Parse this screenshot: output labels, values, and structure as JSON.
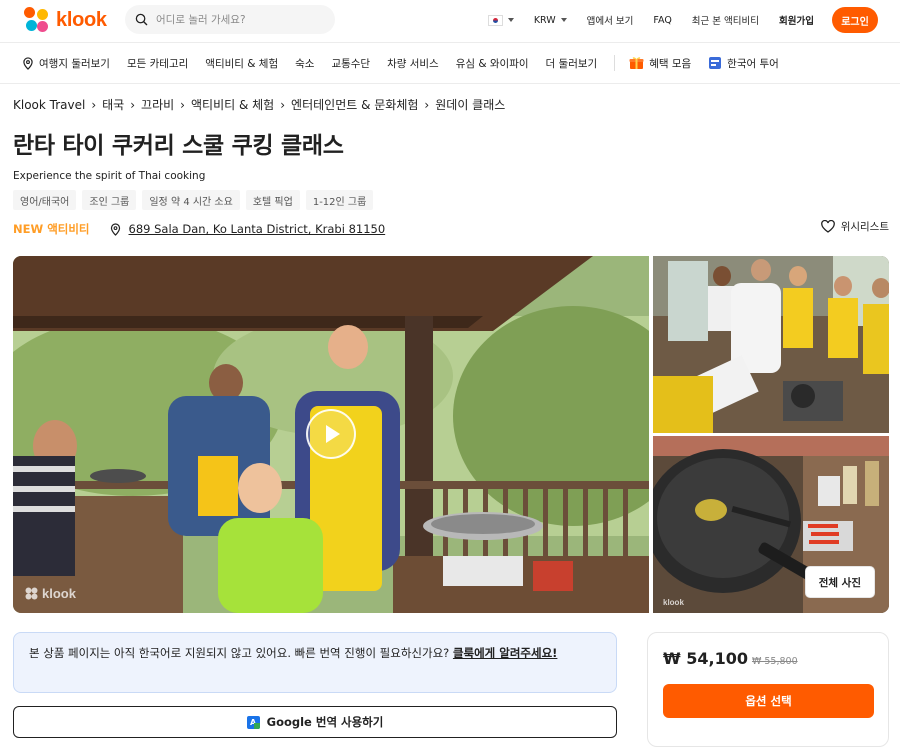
{
  "header": {
    "logo_text": "klook",
    "search_placeholder": "어디로 놀러 가세요?",
    "currency": "KRW",
    "app_link": "앱에서 보기",
    "faq": "FAQ",
    "recent": "최근 본 액티비티",
    "signup": "회원가입",
    "login": "로그인"
  },
  "nav": {
    "items": [
      "여행지 둘러보기",
      "모든 카테고리",
      "액티비티 & 체험",
      "숙소",
      "교통수단",
      "차량 서비스",
      "유심 & 와이파이",
      "더 둘러보기"
    ],
    "deals": "혜택 모음",
    "korean_tour": "한국어 투어"
  },
  "breadcrumb": [
    "Klook Travel",
    "태국",
    "끄라비",
    "액티비티 & 체험",
    "엔터테인먼트 & 문화체험",
    "원데이 클래스"
  ],
  "activity": {
    "title": "란타 타이 쿠커리 스쿨 쿠킹 클래스",
    "subtitle": "Experience the spirit of Thai cooking",
    "tags": [
      "영어/태국어",
      "조인 그룹",
      "일정 약 4 시간 소요",
      "호텔 픽업",
      "1-12인 그룹"
    ],
    "new_prefix": "NEW",
    "new_label": "액티비티",
    "address": "689 Sala Dan, Ko Lanta District, Krabi 81150",
    "wishlist": "위시리스트"
  },
  "gallery": {
    "watermark": "klook",
    "all_photos": "전체 사진"
  },
  "notice": {
    "text": "본 상품 페이지는 아직 한국어로 지원되지 않고 있어요. 빠른 번역 진행이 필요하신가요?",
    "link": "클룩에게 알려주세요!"
  },
  "google_translate": {
    "label": "Google 번역 사용하기"
  },
  "booking": {
    "price": "₩ 54,100",
    "original_price": "₩ 55,800",
    "select_option": "옵션 선택"
  },
  "colors": {
    "brand": "#ff5b00",
    "new_badge": "#ff9d26",
    "notice_bg": "#eef3fd"
  }
}
